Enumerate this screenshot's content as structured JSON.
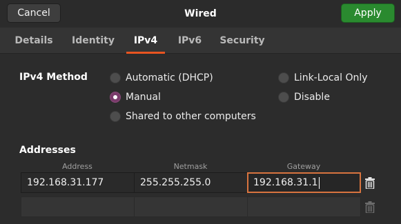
{
  "header": {
    "title": "Wired",
    "cancel_label": "Cancel",
    "apply_label": "Apply"
  },
  "tabs": [
    {
      "label": "Details",
      "active": false
    },
    {
      "label": "Identity",
      "active": false
    },
    {
      "label": "IPv4",
      "active": true
    },
    {
      "label": "IPv6",
      "active": false
    },
    {
      "label": "Security",
      "active": false
    }
  ],
  "ipv4_method": {
    "label": "IPv4 Method",
    "options": [
      {
        "label": "Automatic (DHCP)",
        "checked": false
      },
      {
        "label": "Manual",
        "checked": true
      },
      {
        "label": "Shared to other computers",
        "checked": false
      },
      {
        "label": "Link-Local Only",
        "checked": false
      },
      {
        "label": "Disable",
        "checked": false
      }
    ]
  },
  "addresses": {
    "label": "Addresses",
    "columns": [
      "Address",
      "Netmask",
      "Gateway"
    ],
    "rows": [
      {
        "address": "192.168.31.177",
        "netmask": "255.255.255.0",
        "gateway": "192.168.31.1"
      },
      {
        "address": "",
        "netmask": "",
        "gateway": ""
      }
    ]
  },
  "colors": {
    "accent": "#e95420",
    "apply_green": "#2a8a2f",
    "radio_checked": "#7a3b6b"
  }
}
